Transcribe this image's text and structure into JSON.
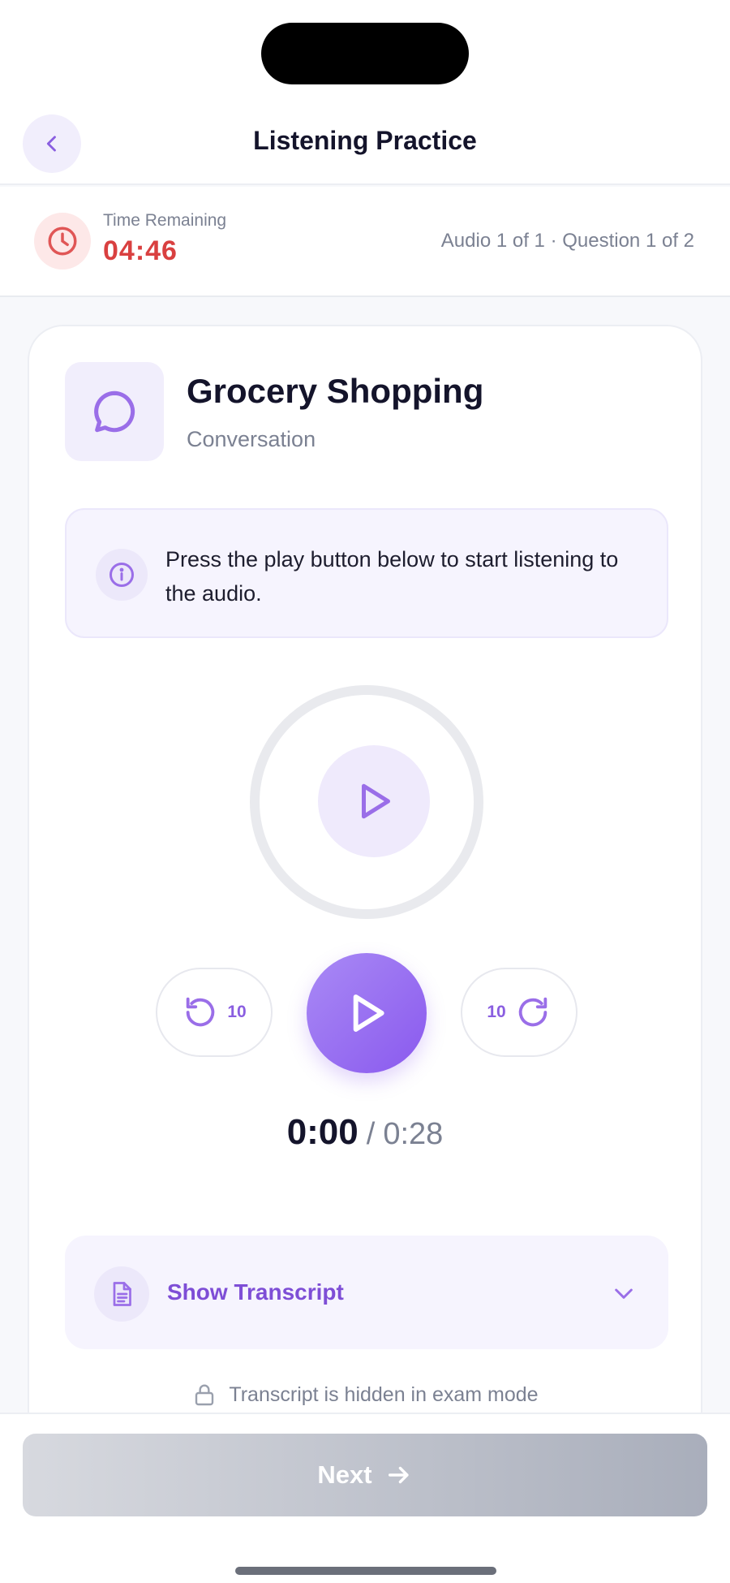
{
  "header": {
    "title": "Listening Practice",
    "back_icon": "chevron-left-icon"
  },
  "timer": {
    "label": "Time Remaining",
    "value": "04:46",
    "progress": "Audio 1 of 1 · Question 1 of 2",
    "icon": "clock-icon",
    "color": "#d94040"
  },
  "topic": {
    "title": "Grocery Shopping",
    "subtitle": "Conversation",
    "icon": "chat-bubble-icon"
  },
  "info": {
    "text": "Press the play button below to start listening to the audio.",
    "icon": "info-icon"
  },
  "player": {
    "rewind_label": "10",
    "forward_label": "10",
    "current_time": "0:00",
    "separator": "/",
    "total_time": "0:28",
    "accent": "#8a59ee"
  },
  "transcript": {
    "label": "Show Transcript",
    "note": "Transcript is hidden in exam mode",
    "icon": "document-icon"
  },
  "footer": {
    "next_label": "Next"
  }
}
